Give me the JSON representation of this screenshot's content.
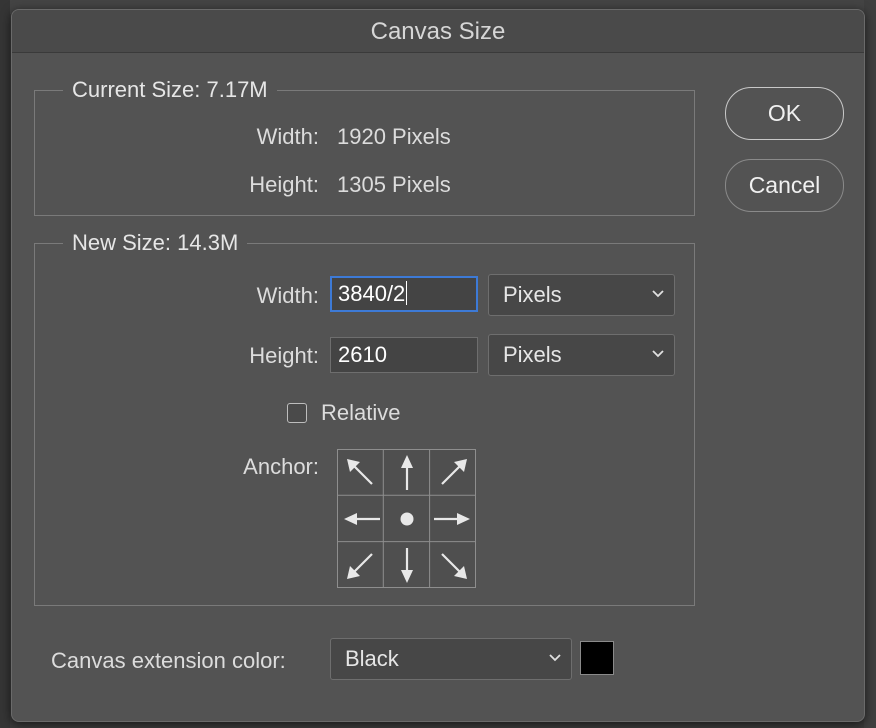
{
  "dialog": {
    "title": "Canvas Size"
  },
  "current_size": {
    "legend": "Current Size: 7.17M",
    "width_label": "Width:",
    "width_value": "1920 Pixels",
    "height_label": "Height:",
    "height_value": "1305 Pixels"
  },
  "new_size": {
    "legend": "New Size: 14.3M",
    "width_label": "Width:",
    "width_value": "3840/2",
    "width_unit": "Pixels",
    "height_label": "Height:",
    "height_value": "2610",
    "height_unit": "Pixels",
    "relative_label": "Relative",
    "relative_checked": false,
    "anchor_label": "Anchor:",
    "anchor_selected": "center"
  },
  "extension": {
    "label": "Canvas extension color:",
    "value": "Black",
    "swatch_color": "#000000"
  },
  "buttons": {
    "ok": "OK",
    "cancel": "Cancel"
  },
  "icons": {
    "anchor_arrows": [
      "arrow-up-left-icon",
      "arrow-up-icon",
      "arrow-up-right-icon",
      "arrow-left-icon",
      "anchor-center-dot-icon",
      "arrow-right-icon",
      "arrow-down-left-icon",
      "arrow-down-icon",
      "arrow-down-right-icon"
    ],
    "dropdown": "chevron-down-icon"
  },
  "colors": {
    "dialog_bg": "#535353",
    "focus_ring": "#3d7ad6"
  }
}
